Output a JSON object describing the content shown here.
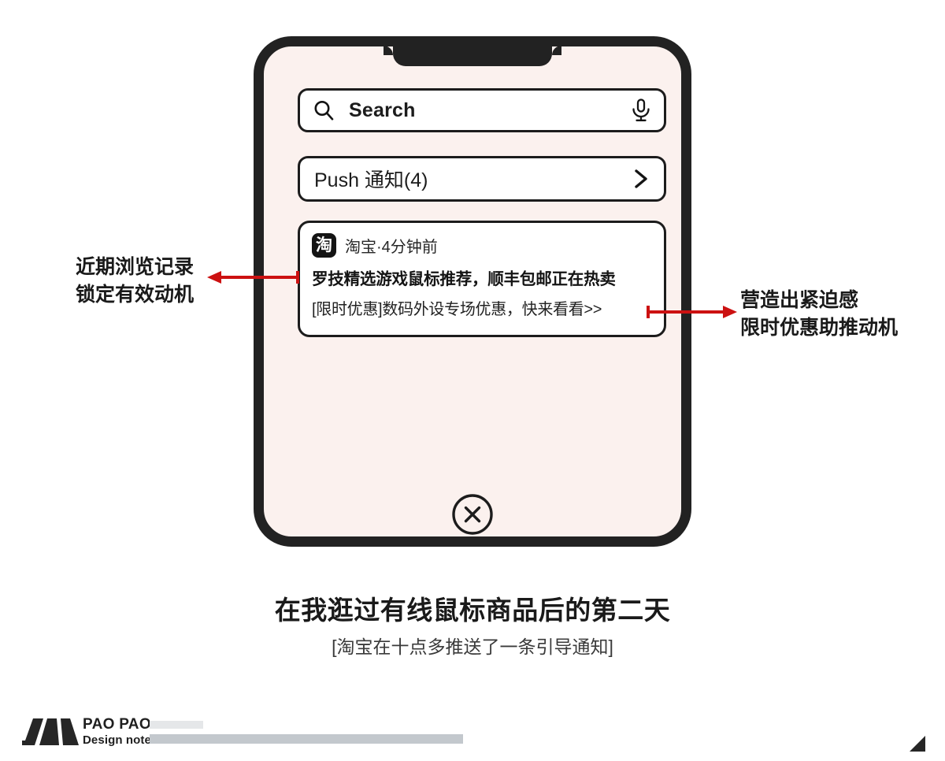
{
  "phone": {
    "search": {
      "placeholder": "Search",
      "search_icon": "search-icon",
      "mic_icon": "microphone-icon"
    },
    "push_row": {
      "label": "Push 通知(4)",
      "chevron_icon": "chevron-right-icon"
    },
    "notification": {
      "app_icon_glyph": "淘",
      "app_icon_name": "taobao-app-icon",
      "meta": "淘宝·4分钟前",
      "title": "罗技精选游戏鼠标推荐，顺丰包邮正在热卖",
      "body": "[限时优惠]数码外设专场优惠，快来看看>>"
    },
    "close_button": {
      "icon": "close-circle-icon"
    },
    "screen_color": "#FBF1EE",
    "frame_color": "#222222"
  },
  "annotations": {
    "accent_color": "#CC1111",
    "left": {
      "line1": "近期浏览记录",
      "line2": "锁定有效动机"
    },
    "right": {
      "line1": "营造出紧迫感",
      "line2": "限时优惠助推动机"
    }
  },
  "caption": {
    "main": "在我逛过有线鼠标商品后的第二天",
    "sub": "[淘宝在十点多推送了一条引导通知]"
  },
  "footer": {
    "brand_top": "PAO PAO",
    "brand_sub": "Design notes",
    "bar_top_color": "#E5E7E9",
    "bar_bottom_color": "#C3C8CD"
  }
}
